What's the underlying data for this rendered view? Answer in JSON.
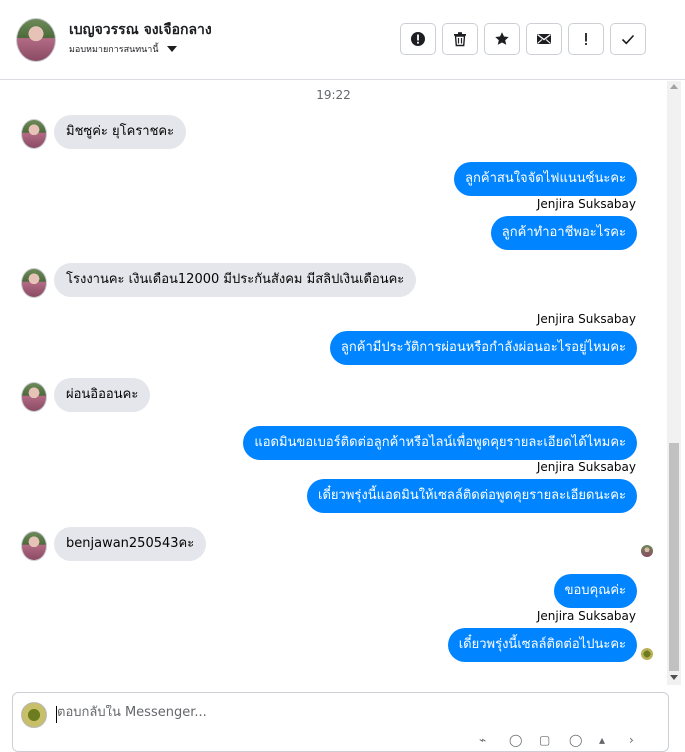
{
  "header": {
    "contact_name": "เบญจวรรณ จงเจือกลาง",
    "assign_label": "มอบหมายการสนทนานี้",
    "toolbar": [
      {
        "icon": "alert-circle-icon",
        "glyph": "!"
      },
      {
        "icon": "trash-icon",
        "glyph": ""
      },
      {
        "icon": "star-icon",
        "glyph": "★"
      },
      {
        "icon": "envelope-icon",
        "glyph": ""
      },
      {
        "icon": "exclamation-icon",
        "glyph": "!"
      },
      {
        "icon": "checkmark-icon",
        "glyph": "✓"
      }
    ]
  },
  "thread": {
    "timestamp": "19:22",
    "messages": [
      {
        "dir": "in",
        "text": "มิชซูค่ะ ยุโคราชคะ"
      },
      {
        "dir": "out",
        "text": "ลูกค้าสนใจจัดไฟแนนซ์นะคะ"
      },
      {
        "dir": "sender",
        "text": "Jenjira Suksabay"
      },
      {
        "dir": "out",
        "text": "ลูกค้าทำอาชีพอะไรคะ"
      },
      {
        "dir": "in",
        "text": "โรงงานคะ เงินเดือน12000 มีประกันสังคม มีสลิปเงินเดือนคะ"
      },
      {
        "dir": "sender",
        "text": "Jenjira Suksabay"
      },
      {
        "dir": "out",
        "text": "ลูกค้ามีประวัติการผ่อนหรือกำลังผ่อนอะไรอยู่ไหมคะ"
      },
      {
        "dir": "in",
        "text": "ผ่อนอิออนคะ"
      },
      {
        "dir": "out",
        "text": "แอดมินขอเบอร์ติดต่อลูกค้าหรือไลน์เพื่อพูดคุยรายละเอียดได้ไหมคะ"
      },
      {
        "dir": "sender",
        "text": "Jenjira Suksabay"
      },
      {
        "dir": "out",
        "text": "เดี๋ยวพรุ่งนี้แอดมินให้เซลล์ติดต่อพูดคุยรายละเอียดนะคะ"
      },
      {
        "dir": "in",
        "text": "benjawan250543คะ"
      },
      {
        "dir": "out",
        "text": "ขอบคุณค่ะ"
      },
      {
        "dir": "sender",
        "text": "Jenjira Suksabay"
      },
      {
        "dir": "out",
        "text": "เดี๋ยวพรุ่งนี้เซลล์ติดต่อไปนะคะ"
      }
    ]
  },
  "composer": {
    "placeholder": "ตอบกลับใน Messenger..."
  },
  "colors": {
    "outgoing_bubble": "#0084ff",
    "incoming_bubble": "#e4e6eb"
  }
}
